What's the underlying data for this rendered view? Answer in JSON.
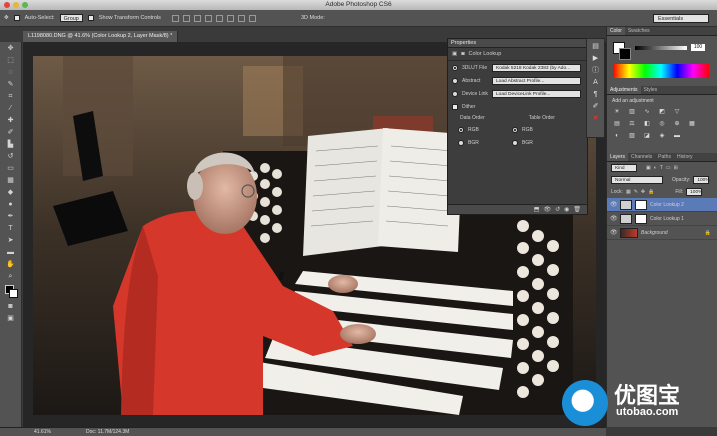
{
  "app": {
    "title": "Adobe Photoshop CS6"
  },
  "options_bar": {
    "auto_select_label": "Auto-Select:",
    "auto_select_value": "Group",
    "show_transform_label": "Show Transform Controls",
    "mode_3d_label": "3D Mode:",
    "workspace": "Essentials"
  },
  "document": {
    "tab_title": "L1198080.DNG @ 41.6% (Color Lookup 2, Layer Mask/8) *"
  },
  "properties_panel": {
    "title": "Properties",
    "subtitle": "Color Lookup",
    "rows": [
      {
        "label": "3DLUT File",
        "value": "Kodak 5218 Kodak 2383 (by Ado...",
        "selected": true
      },
      {
        "label": "Abstract",
        "value": "Load Abstract Profile...",
        "selected": false
      },
      {
        "label": "Device Link",
        "value": "Load DeviceLink Profile...",
        "selected": false
      }
    ],
    "dither_label": "Dither",
    "data_order_label": "Data Order",
    "table_order_label": "Table Order",
    "order_options": [
      "RGB",
      "BGR"
    ]
  },
  "color_panel": {
    "tabs": [
      "Color",
      "Swatches"
    ],
    "value": "100"
  },
  "adjustments_panel": {
    "tabs": [
      "Adjustments",
      "Styles"
    ],
    "heading": "Add an adjustment"
  },
  "layers_panel": {
    "tabs": [
      "Layers",
      "Channels",
      "Paths",
      "History"
    ],
    "filter_kind": "Kind",
    "blend_mode": "Normal",
    "opacity_label": "Opacity:",
    "opacity_value": "100%",
    "lock_label": "Lock:",
    "fill_label": "Fill:",
    "fill_value": "100%",
    "layers": [
      {
        "name": "Color Lookup 2",
        "selected": true
      },
      {
        "name": "Color Lookup 1",
        "selected": false
      },
      {
        "name": "Background",
        "selected": false
      }
    ]
  },
  "status_bar": {
    "zoom": "41.61%",
    "doc_info": "Doc: 11.7M/124.3M"
  },
  "watermark": {
    "brand_cn": "优图宝",
    "url": "utobao.com"
  },
  "colors": {
    "accent_selected": "#5a7ab8",
    "panel_bg": "#535353",
    "logo_blue": "#1a8fd8"
  }
}
